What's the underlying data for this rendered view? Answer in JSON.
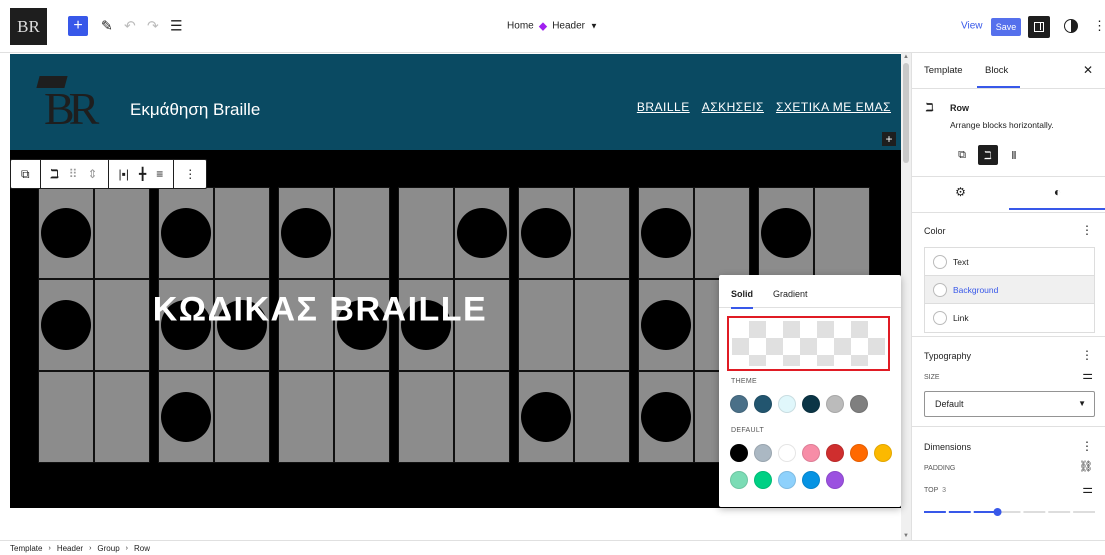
{
  "topbar": {
    "site_icon_text": "BR",
    "doc_title": {
      "page": "Home",
      "template": "Header"
    },
    "view_label": "View",
    "save_label": "Save"
  },
  "header_block": {
    "site_title": "Εκμάθηση Braille",
    "nav": [
      "BRAILLE",
      "ΑΣΚΗΣΕΙΣ",
      "ΣΧΕΤΙΚΑ ΜΕ ΕΜΑΣ"
    ],
    "bg_color": "#0a4a62"
  },
  "cover": {
    "title": "ΚΩΔΙΚΑΣ BRAILLE"
  },
  "color_popover": {
    "tabs": [
      "Solid",
      "Gradient"
    ],
    "active_tab": "Solid",
    "theme_label": "THEME",
    "theme_colors": [
      "#4a7088",
      "#22556f",
      "#e0f7fb",
      "#0b3546",
      "#bbbbbb",
      "#7f7f7f"
    ],
    "default_label": "DEFAULT",
    "default_colors": [
      "#000000",
      "#abb8c3",
      "#ffffff",
      "#f78da7",
      "#cf2e2e",
      "#ff6900",
      "#fcb900",
      "#7bdcb5",
      "#00d084",
      "#8ed1fc",
      "#0693e3",
      "#9b51e0"
    ]
  },
  "sidebar": {
    "tabs": [
      "Template",
      "Block"
    ],
    "active_tab": "Block",
    "block": {
      "name": "Row",
      "description": "Arrange blocks horizontally."
    },
    "color": {
      "title": "Color",
      "items": [
        "Text",
        "Background",
        "Link"
      ],
      "active": "Background"
    },
    "typography": {
      "title": "Typography",
      "size_label": "SIZE",
      "size_value": "Default"
    },
    "dimensions": {
      "title": "Dimensions",
      "padding_label": "PADDING",
      "top_label": "TOP",
      "top_value": "3",
      "padding_level": 0.43
    }
  },
  "breadcrumb": [
    "Template",
    "Header",
    "Group",
    "Row"
  ],
  "accent": "#3858e9"
}
